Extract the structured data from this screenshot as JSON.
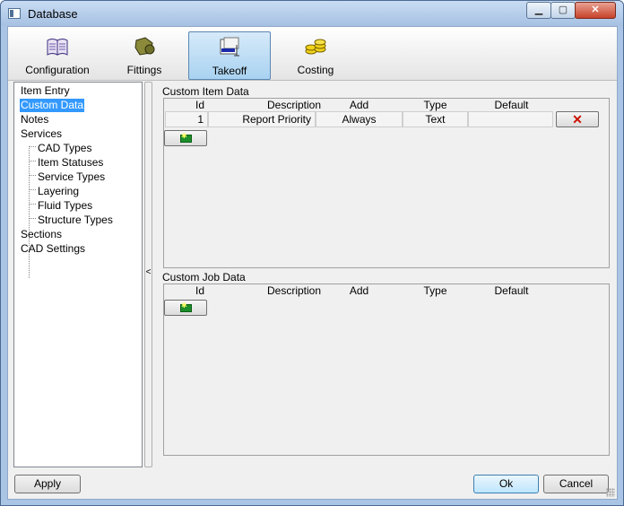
{
  "window": {
    "title": "Database",
    "min_glyph": "▁",
    "max_glyph": "▢",
    "close_glyph": "✕"
  },
  "toolbar": [
    {
      "label": "Configuration",
      "icon": "book-icon"
    },
    {
      "label": "Fittings",
      "icon": "fittings-icon"
    },
    {
      "label": "Takeoff",
      "icon": "takeoff-icon",
      "active": true
    },
    {
      "label": "Costing",
      "icon": "coins-icon"
    }
  ],
  "tree": {
    "items": [
      {
        "label": "Item Entry"
      },
      {
        "label": "Custom Data",
        "selected": true
      },
      {
        "label": "Notes"
      },
      {
        "label": "Services"
      },
      {
        "label": "CAD Types"
      },
      {
        "label": "Item Statuses"
      },
      {
        "label": "Service Types"
      },
      {
        "label": "Layering"
      },
      {
        "label": "Fluid Types"
      },
      {
        "label": "Structure Types"
      },
      {
        "label": "Sections"
      },
      {
        "label": "CAD Settings"
      }
    ]
  },
  "splitter_glyph": "<",
  "custom_item": {
    "title": "Custom Item Data",
    "columns": [
      "Id",
      "Description",
      "Add",
      "Type",
      "Default"
    ],
    "rows": [
      {
        "id": "1",
        "description": "Report Priority",
        "add": "Always",
        "type": "Text",
        "default": ""
      }
    ],
    "delete_glyph": "✕"
  },
  "custom_job": {
    "title": "Custom Job Data",
    "columns": [
      "Id",
      "Description",
      "Add",
      "Type",
      "Default"
    ]
  },
  "buttons": {
    "apply": "Apply",
    "ok": "Ok",
    "cancel": "Cancel"
  },
  "colors": {
    "selection": "#3399ff",
    "delete": "#cc1100",
    "add": "#1c8f2a"
  }
}
